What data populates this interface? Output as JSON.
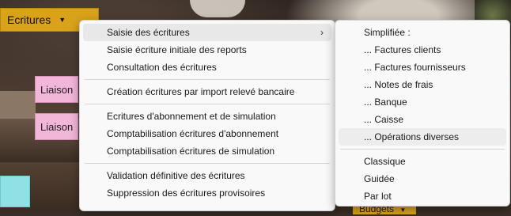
{
  "app": {
    "ecritures_label": "Ecritures",
    "liaison_labels": [
      "Liaison",
      "Liaison"
    ],
    "budgets_label": "Budgets"
  },
  "menu": {
    "group1": [
      "Saisie des écritures",
      "Saisie écriture initiale des reports",
      "Consultation des écritures"
    ],
    "group2": [
      "Création écritures par import relevé bancaire"
    ],
    "group3": [
      "Ecritures d'abonnement et de simulation",
      "Comptabilisation écritures d'abonnement",
      "Comptabilisation écritures de simulation"
    ],
    "group4": [
      "Validation définitive des écritures",
      "Suppression des écritures provisoires"
    ]
  },
  "submenu": {
    "header": "Simplifiée :",
    "simplified": [
      "... Factures clients",
      "... Factures fournisseurs",
      "... Notes de frais",
      "... Banque",
      "... Caisse",
      "... Opérations diverses"
    ],
    "other": [
      "Classique",
      "Guidée",
      "Par lot"
    ]
  },
  "icons": {
    "dropdown": "caret-down-icon",
    "submenu": "chevron-right-icon"
  },
  "colors": {
    "accent": "#d9a21a",
    "liaison": "#f2b6d8",
    "menu_bg": "#f9f9f9"
  }
}
